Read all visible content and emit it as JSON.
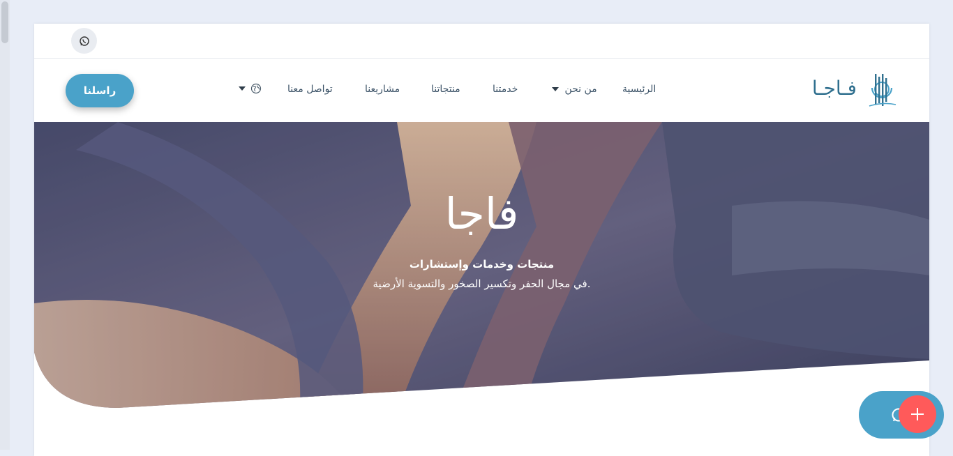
{
  "nav": {
    "contact_button": "راسلنا",
    "items": [
      {
        "label": "الرئيسية"
      },
      {
        "label": "من نحن"
      },
      {
        "label": "خدمتنا"
      },
      {
        "label": "منتجاتنا"
      },
      {
        "label": "مشاريعنا"
      },
      {
        "label": "تواصل معنا"
      }
    ],
    "language_icon": "globe-icon"
  },
  "brand": {
    "name": "فـاجـا"
  },
  "topbar": {
    "whatsapp_icon": "whatsapp-icon"
  },
  "hero": {
    "title": "فاجا",
    "subtitle": "منتجات وخدمات وإستشارات",
    "description": "في مجال الحفر وتكسير الصخور والتسوية الأرضية."
  },
  "fab": {
    "plus_icon": "plus-icon",
    "chat_icon": "whatsapp-icon"
  },
  "colors": {
    "accent": "#4aa2c9",
    "fab_red": "#ff5a5a",
    "nav_text": "#3a5166"
  }
}
